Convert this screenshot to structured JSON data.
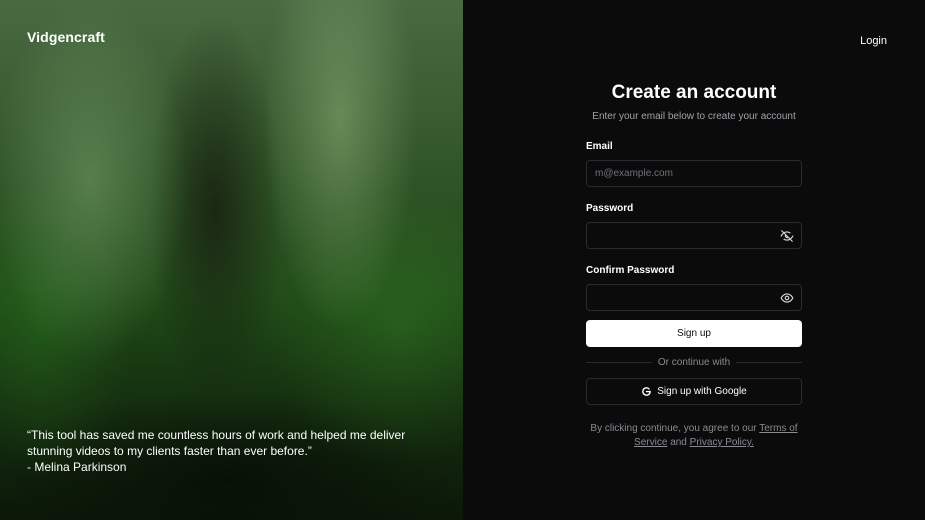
{
  "brand": {
    "name": "Vidgencraft"
  },
  "testimonial": {
    "quote": "“This tool has saved me countless hours of work and helped me deliver stunning videos to my clients faster than ever before.”",
    "author": "- Melina Parkinson"
  },
  "header": {
    "login_label": "Login"
  },
  "form": {
    "title": "Create an account",
    "subtitle": "Enter your email below to create your account",
    "email_label": "Email",
    "email_placeholder": "m@example.com",
    "email_value": "",
    "password_label": "Password",
    "password_value": "",
    "confirm_label": "Confirm Password",
    "confirm_value": "",
    "password_toggle_icon": "eye-off-icon",
    "confirm_toggle_icon": "eye-icon",
    "signup_label": "Sign up",
    "divider_text": "Or continue with",
    "google_label": "Sign up with Google",
    "google_icon": "google-icon"
  },
  "legal": {
    "prefix": "By clicking continue, you agree to our",
    "terms_link": "Terms of Service",
    "and": "and",
    "privacy_link": "Privacy Policy."
  },
  "colors": {
    "background": "#0b0b0c",
    "border": "#2b2b2f",
    "muted": "#a1a1aa",
    "button": "#ffffff"
  }
}
